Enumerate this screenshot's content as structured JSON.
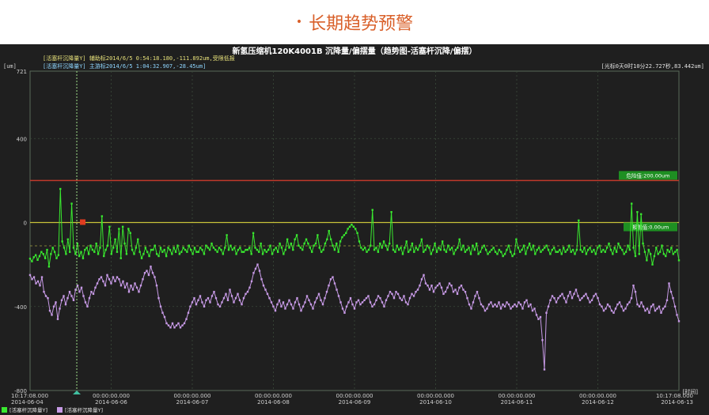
{
  "page_heading": {
    "bullet": "•",
    "title": "长期趋势预警"
  },
  "colors": {
    "heading": "#d9602a",
    "background": "#1f1f1f",
    "series_upper": "#39e82f",
    "series_lower": "#c79ae6",
    "alarm_line": "#c0392b",
    "warning_line": "#c9c23a",
    "cursor": "#9fe08a"
  },
  "chart_data": {
    "type": "line",
    "title": "新氢压缩机120K4001B 沉降量/偏摆量（趋势图-活塞杆沉降/偏摆）",
    "unit_label": "[um]",
    "info_lines": [
      "[活塞杆沉降量Y] 辅助标2014/6/5 0:54:18.180,-111.892um,受限低报",
      "[活塞杆沉降量Y] 主游标2014/6/5 1:04:32.907,-28.45um]"
    ],
    "top_right_info": "[光标0天0时10分22.727秒,83.442um]",
    "ylim": [
      -800,
      721
    ],
    "y_ticks": [
      721,
      400,
      0,
      -400,
      -800
    ],
    "x_axis_label": "[时间]",
    "x_ticks": [
      {
        "time": "10:17:08.000",
        "date": "2014-06-04"
      },
      {
        "time": "00:00:00.000",
        "date": "2014-06-06"
      },
      {
        "time": "00:00:00.000",
        "date": "2014-06-07"
      },
      {
        "time": "00:00:00.000",
        "date": "2014-06-08"
      },
      {
        "time": "00:00:00.000",
        "date": "2014-06-09"
      },
      {
        "time": "00:00:00.000",
        "date": "2014-06-10"
      },
      {
        "time": "00:00:00.000",
        "date": "2014-06-11"
      },
      {
        "time": "00:00:00.000",
        "date": "2014-06-12"
      },
      {
        "time": "10:17:08.000",
        "date": "2014-06-13"
      }
    ],
    "alarm_line": {
      "label": "危险值:200.00um",
      "value": 200
    },
    "warning_line": {
      "label": "报警值:0.00um",
      "value": 0
    },
    "mid_line_value": -111,
    "cursor_fraction": 0.072,
    "series": [
      {
        "name": "活塞杆沉降量Y",
        "color": "#39e82f",
        "values": [
          -172,
          -185,
          -165,
          -155,
          -178,
          -160,
          -140,
          -150,
          -170,
          -130,
          -210,
          -150,
          -120,
          -140,
          -170,
          -155,
          160,
          -90,
          -120,
          -150,
          -80,
          -140,
          90,
          -120,
          -150,
          -100,
          -160,
          -140,
          -170,
          -130,
          -120,
          -150,
          -110,
          -130,
          -140,
          -100,
          -150,
          -120,
          30,
          -160,
          -130,
          -110,
          -20,
          -150,
          -120,
          -80,
          -140,
          -30,
          -170,
          -20,
          -100,
          -150,
          -30,
          -50,
          -130,
          -150,
          -120,
          -80,
          -140,
          -170,
          -150,
          -120,
          -140,
          -160,
          -130,
          -130,
          -110,
          -150,
          -160,
          -120,
          -140,
          -130,
          -160,
          -120,
          -130,
          -150,
          -120,
          -140,
          -110,
          -150,
          -140,
          -120,
          -130,
          -140,
          -110,
          -130,
          -150,
          -120,
          -140,
          -140,
          -120,
          -130,
          -150,
          -110,
          -120,
          -130,
          -100,
          -120,
          -130,
          -140,
          -120,
          -130,
          -150,
          -120,
          -60,
          -130,
          -110,
          -130,
          -120,
          -150,
          -130,
          -120,
          -140,
          -140,
          -130,
          -130,
          -120,
          -150,
          -50,
          -120,
          -130,
          -140,
          -100,
          -150,
          -130,
          -140,
          -130,
          -110,
          -150,
          -130,
          -120,
          -140,
          -100,
          -120,
          -150,
          -130,
          -80,
          -120,
          -100,
          -130,
          -80,
          -60,
          -110,
          -120,
          -130,
          -100,
          -80,
          -100,
          -120,
          -140,
          -110,
          -100,
          -60,
          -120,
          -140,
          -130,
          -100,
          -80,
          -40,
          -80,
          -110,
          -130,
          -100,
          -140,
          -90,
          -70,
          -60,
          -50,
          -30,
          -20,
          -10,
          -20,
          -30,
          -50,
          -90,
          -120,
          -130,
          -120,
          -140,
          -130,
          -110,
          60,
          -130,
          -120,
          -140,
          -100,
          -120,
          -90,
          -110,
          -130,
          -100,
          50,
          -130,
          -140,
          -110,
          -130,
          -120,
          -150,
          -120,
          -90,
          -140,
          -130,
          -100,
          -140,
          -120,
          -130,
          -110,
          -80,
          -140,
          -130,
          -110,
          -120,
          -150,
          -130,
          -100,
          -140,
          -120,
          -130,
          -90,
          -130,
          -140,
          -110,
          -130,
          -120,
          -150,
          -130,
          -120,
          -80,
          -130,
          -110,
          -140,
          -130,
          -120,
          -150,
          -110,
          -130,
          -100,
          -150,
          -140,
          -120,
          -110,
          -130,
          -150,
          -140,
          -130,
          -120,
          -140,
          -150,
          -130,
          -140,
          -160,
          -150,
          -130,
          -110,
          -140,
          -160,
          -150,
          -80,
          -120,
          -140,
          -130,
          -110,
          -150,
          -120,
          -100,
          -130,
          -110,
          -150,
          -130,
          -120,
          -140,
          -130,
          -120,
          -110,
          -130,
          -150,
          -130,
          -120,
          -140,
          -140,
          -130,
          -150,
          -120,
          -140,
          -130,
          -110,
          -140,
          -130,
          -150,
          -130,
          10,
          -130,
          -140,
          -120,
          -150,
          -130,
          -120,
          -140,
          -130,
          -150,
          -120,
          -110,
          -140,
          -130,
          -140,
          -120,
          -100,
          -130,
          -150,
          -120,
          -140,
          -100,
          -120,
          -130,
          -150,
          -140,
          -110,
          -130,
          90,
          -120,
          -160,
          50,
          -150,
          40,
          -100,
          -140,
          -180,
          -130,
          -150,
          -200,
          -160,
          -120,
          -150,
          -140,
          -110,
          -150,
          -160,
          -130,
          -140,
          -120,
          -150,
          -140,
          -130,
          -180
        ]
      },
      {
        "name": "活塞杆沉降量Y",
        "color": "#c79ae6",
        "values": [
          -250,
          -270,
          -260,
          -290,
          -280,
          -300,
          -260,
          -330,
          -350,
          -360,
          -420,
          -440,
          -400,
          -380,
          -460,
          -410,
          -370,
          -350,
          -390,
          -360,
          -330,
          -350,
          -370,
          -320,
          -300,
          -330,
          -310,
          -350,
          -380,
          -400,
          -360,
          -330,
          -340,
          -310,
          -290,
          -270,
          -260,
          -280,
          -300,
          -250,
          -270,
          -290,
          -260,
          -280,
          -260,
          -270,
          -300,
          -280,
          -310,
          -290,
          -330,
          -300,
          -320,
          -290,
          -310,
          -330,
          -300,
          -270,
          -240,
          -230,
          -250,
          -210,
          -240,
          -260,
          -300,
          -360,
          -400,
          -430,
          -450,
          -480,
          -490,
          -500,
          -480,
          -500,
          -490,
          -480,
          -500,
          -490,
          -480,
          -460,
          -430,
          -400,
          -380,
          -360,
          -390,
          -370,
          -350,
          -380,
          -400,
          -370,
          -360,
          -380,
          -350,
          -330,
          -360,
          -390,
          -400,
          -380,
          -360,
          -340,
          -370,
          -320,
          -350,
          -380,
          -360,
          -340,
          -370,
          -390,
          -360,
          -340,
          -330,
          -310,
          -280,
          -240,
          -220,
          -200,
          -230,
          -270,
          -300,
          -320,
          -340,
          -360,
          -380,
          -400,
          -420,
          -390,
          -370,
          -400,
          -380,
          -410,
          -390,
          -370,
          -390,
          -410,
          -380,
          -360,
          -390,
          -420,
          -400,
          -380,
          -350,
          -370,
          -390,
          -410,
          -380,
          -360,
          -340,
          -370,
          -390,
          -360,
          -330,
          -300,
          -270,
          -260,
          -290,
          -320,
          -350,
          -380,
          -410,
          -430,
          -400,
          -380,
          -360,
          -390,
          -410,
          -380,
          -370,
          -390,
          -380,
          -370,
          -360,
          -350,
          -380,
          -400,
          -390,
          -370,
          -350,
          -360,
          -380,
          -400,
          -370,
          -350,
          -330,
          -340,
          -360,
          -330,
          -340,
          -360,
          -370,
          -350,
          -380,
          -390,
          -360,
          -340,
          -350,
          -330,
          -320,
          -300,
          -270,
          -250,
          -290,
          -300,
          -320,
          -300,
          -330,
          -310,
          -300,
          -290,
          -310,
          -340,
          -330,
          -310,
          -290,
          -300,
          -330,
          -320,
          -340,
          -310,
          -300,
          -320,
          -330,
          -360,
          -390,
          -410,
          -380,
          -350,
          -330,
          -360,
          -390,
          -400,
          -420,
          -410,
          -390,
          -380,
          -400,
          -390,
          -400,
          -380,
          -410,
          -390,
          -400,
          -380,
          -390,
          -410,
          -400,
          -390,
          -400,
          -380,
          -390,
          -410,
          -380,
          -370,
          -400,
          -390,
          -420,
          -410,
          -440,
          -460,
          -450,
          -560,
          -700,
          -430,
          -400,
          -370,
          -350,
          -360,
          -380,
          -360,
          -350,
          -340,
          -360,
          -380,
          -350,
          -330,
          -360,
          -340,
          -320,
          -350,
          -370,
          -360,
          -350,
          -340,
          -360,
          -380,
          -370,
          -350,
          -340,
          -360,
          -390,
          -400,
          -420,
          -410,
          -390,
          -400,
          -420,
          -430,
          -410,
          -390,
          -380,
          -400,
          -420,
          -410,
          -390,
          -380,
          -360,
          -300,
          -330,
          -390,
          -400,
          -380,
          -400,
          -420,
          -410,
          -430,
          -400,
          -390,
          -420,
          -410,
          -400,
          -430,
          -410,
          -400,
          -370,
          -290,
          -330,
          -360,
          -400,
          -440,
          -470
        ]
      }
    ],
    "legend": [
      {
        "label": "[活塞杆沉降量Y]",
        "color": "#39e82f"
      },
      {
        "label": "[活塞杆沉降量Y]",
        "color": "#c79ae6"
      }
    ],
    "grid": true
  }
}
